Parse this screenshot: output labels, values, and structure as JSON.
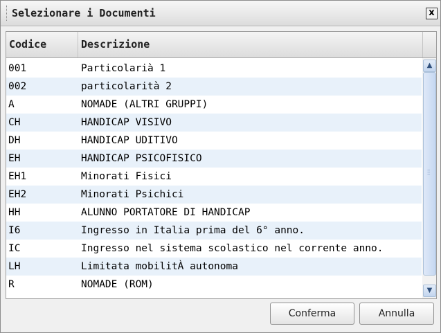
{
  "dialog": {
    "title": "Selezionare i Documenti",
    "close_label": "x"
  },
  "grid": {
    "columns": [
      "Codice",
      "Descrizione"
    ],
    "rows": [
      {
        "code": "001",
        "desc": "Particolarià 1"
      },
      {
        "code": "002",
        "desc": "particolarità 2"
      },
      {
        "code": "A",
        "desc": "NOMADE (ALTRI GRUPPI)"
      },
      {
        "code": "CH",
        "desc": "HANDICAP VISIVO"
      },
      {
        "code": "DH",
        "desc": "HANDICAP UDITIVO"
      },
      {
        "code": "EH",
        "desc": "HANDICAP PSICOFISICO"
      },
      {
        "code": "EH1",
        "desc": "Minorati Fisici"
      },
      {
        "code": "EH2",
        "desc": "Minorati Psichici"
      },
      {
        "code": "HH",
        "desc": "ALUNNO PORTATORE DI HANDICAP"
      },
      {
        "code": "I6",
        "desc": "Ingresso in Italia prima del 6° anno."
      },
      {
        "code": "IC",
        "desc": "Ingresso nel sistema scolastico nel corrente anno."
      },
      {
        "code": "LH",
        "desc": "Limitata mobilitÀ autonoma"
      },
      {
        "code": "R",
        "desc": "NOMADE (ROM)"
      }
    ]
  },
  "buttons": {
    "confirm": "Conferma",
    "cancel": "Annulla"
  },
  "icons": {
    "close": "close-icon",
    "scroll_up": "chevron-up-icon",
    "scroll_down": "chevron-down-icon"
  },
  "colors": {
    "row_alt": "#e8f1fa",
    "scroll_thumb": "#c5d7f1"
  }
}
